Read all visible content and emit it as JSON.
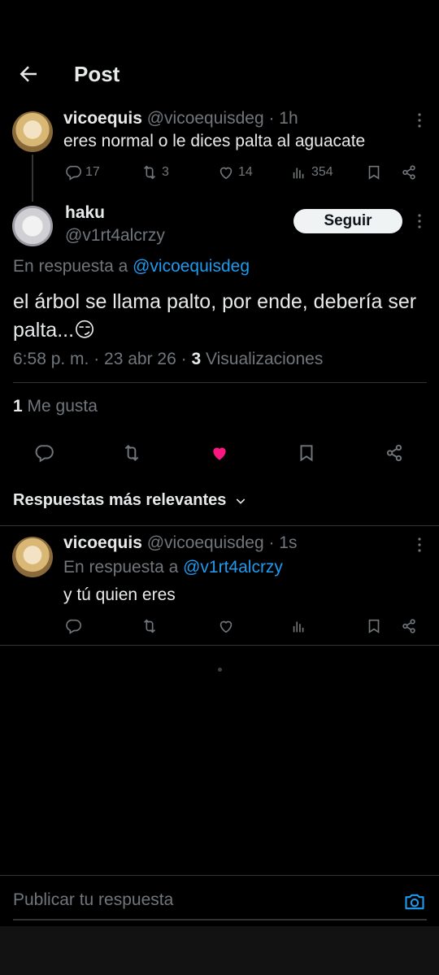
{
  "header": {
    "title": "Post"
  },
  "parent_tweet": {
    "name": "vicoequis",
    "handle": "@vicoequisdeg",
    "time": "· 1h",
    "text": "eres normal o le dices palta al aguacate",
    "replies": "17",
    "reposts": "3",
    "likes": "14",
    "views": "354"
  },
  "main_tweet": {
    "name": "haku",
    "handle": "@v1rt4alcrzy",
    "follow_label": "Seguir",
    "reply_prefix": "En respuesta a ",
    "reply_to": "@vicoequisdeg",
    "text": "el árbol se llama palto, por ende, debería ser palta...😏",
    "time": "6:58 p. m. · 23 abr 26 · ",
    "views_count": "3",
    "views_label": " Visualizaciones",
    "likes_count": "1",
    "likes_label": " Me gusta",
    "liked": true,
    "like_color": "#f91880"
  },
  "sort": {
    "label": "Respuestas más relevantes"
  },
  "reply_tweet": {
    "name": "vicoequis",
    "handle": "@vicoequisdeg",
    "time": "· 1s",
    "reply_prefix": "En respuesta a ",
    "reply_to": "@v1rt4alcrzy",
    "text": "y tú quien eres"
  },
  "composer": {
    "placeholder": "Publicar tu respuesta"
  },
  "colors": {
    "accent": "#1d9bf0",
    "muted": "#71767b",
    "text": "#e7e9ea",
    "background": "#000000"
  }
}
